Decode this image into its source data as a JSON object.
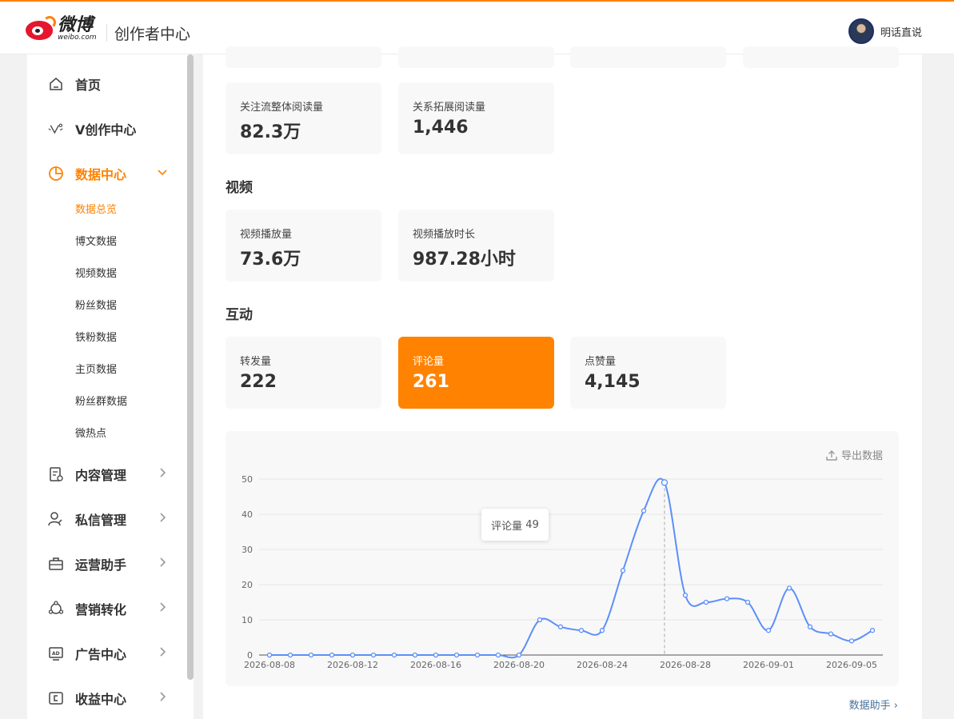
{
  "header": {
    "logo_cn": "微博",
    "logo_en": "weibo.com",
    "app_title": "创作者中心",
    "user_name": "明话直说"
  },
  "sidebar": {
    "items": [
      {
        "label": "首页",
        "icon": "home-icon"
      },
      {
        "label": "V创作中心",
        "icon": "v-creator-icon"
      },
      {
        "label": "数据中心",
        "icon": "pie-chart-icon",
        "active": true,
        "expanded": true
      },
      {
        "label": "内容管理",
        "icon": "document-icon"
      },
      {
        "label": "私信管理",
        "icon": "user-message-icon"
      },
      {
        "label": "运营助手",
        "icon": "briefcase-icon"
      },
      {
        "label": "营销转化",
        "icon": "share-triangle-icon"
      },
      {
        "label": "广告中心",
        "icon": "ad-icon"
      },
      {
        "label": "收益中心",
        "icon": "wallet-icon"
      }
    ],
    "sub_items": [
      "数据总览",
      "博文数据",
      "视频数据",
      "粉丝数据",
      "铁粉数据",
      "主页数据",
      "粉丝群数据",
      "微热点"
    ]
  },
  "reading": {
    "cards": [
      {
        "label": "关注流整体阅读量",
        "value": "82.3万"
      },
      {
        "label": "关系拓展阅读量",
        "value": "1,446"
      }
    ]
  },
  "video": {
    "title": "视频",
    "cards": [
      {
        "label": "视频播放量",
        "value": "73.6万"
      },
      {
        "label": "视频播放时长",
        "value": "987.28小时"
      }
    ]
  },
  "interaction": {
    "title": "互动",
    "cards": [
      {
        "label": "转发量",
        "value": "222"
      },
      {
        "label": "评论量",
        "value": "261",
        "selected": true
      },
      {
        "label": "点赞量",
        "value": "4,145"
      }
    ]
  },
  "export_label": "导出数据",
  "helper_label": "数据助手",
  "tooltip": {
    "label": "评论量",
    "value": "49"
  },
  "colors": {
    "accent": "#ff8200",
    "line": "#5b8ff9"
  },
  "chart_data": {
    "type": "line",
    "series_name": "评论量",
    "x": [
      "2026-08-08",
      "2026-08-09",
      "2026-08-10",
      "2026-08-11",
      "2026-08-12",
      "2026-08-13",
      "2026-08-14",
      "2026-08-15",
      "2026-08-16",
      "2026-08-17",
      "2026-08-18",
      "2026-08-19",
      "2026-08-20",
      "2026-08-21",
      "2026-08-22",
      "2026-08-23",
      "2026-08-24",
      "2026-08-25",
      "2026-08-26",
      "2026-08-27",
      "2026-08-28",
      "2026-08-29",
      "2026-08-30",
      "2026-08-31",
      "2026-09-01",
      "2026-09-02",
      "2026-09-03",
      "2026-09-04",
      "2026-09-05",
      "2026-09-06"
    ],
    "values": [
      0,
      0,
      0,
      0,
      0,
      0,
      0,
      0,
      0,
      0,
      0,
      0,
      0,
      10,
      8,
      7,
      7,
      24,
      41,
      49,
      17,
      15,
      16,
      15,
      7,
      19,
      8,
      6,
      4,
      7
    ],
    "xticks": [
      "2026-08-08",
      "2026-08-12",
      "2026-08-16",
      "2026-08-20",
      "2026-08-24",
      "2026-08-28",
      "2026-09-01",
      "2026-09-05"
    ],
    "yticks": [
      0,
      10,
      20,
      30,
      40,
      50
    ],
    "ylim": [
      0,
      50
    ],
    "grid": true,
    "highlight_index": 19
  }
}
